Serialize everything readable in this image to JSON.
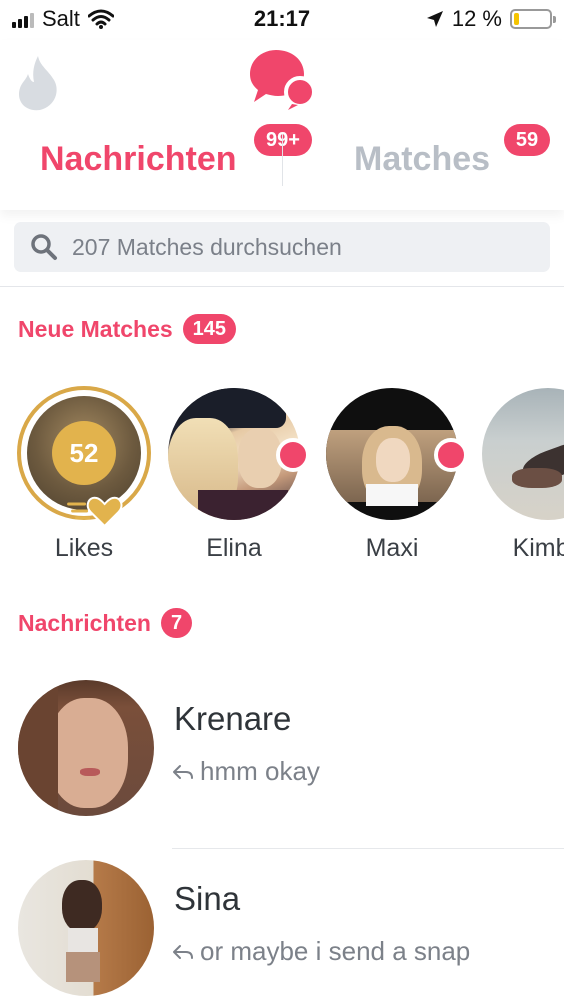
{
  "status_bar": {
    "carrier": "Salt",
    "time": "21:17",
    "battery_percent": "12 %",
    "battery_level": 0.12
  },
  "header": {
    "logo_icon": "chat-bubbles-icon",
    "flame_icon": "flame-icon",
    "tabs": [
      {
        "label": "Nachrichten",
        "badge": "99+",
        "active": true
      },
      {
        "label": "Matches",
        "badge": "59",
        "active": false
      }
    ]
  },
  "search": {
    "placeholder": "207 Matches durchsuchen"
  },
  "new_matches": {
    "title": "Neue Matches",
    "count": "145",
    "items": [
      {
        "name": "Likes",
        "count": "52",
        "type": "likes"
      },
      {
        "name": "Elina",
        "online": true
      },
      {
        "name": "Maxi",
        "online": true
      },
      {
        "name": "Kimbe",
        "online": false
      }
    ]
  },
  "messages": {
    "title": "Nachrichten",
    "count": "7",
    "conversations": [
      {
        "name": "Krenare",
        "preview": "hmm okay"
      },
      {
        "name": "Sina",
        "preview": "or maybe i send a snap"
      }
    ]
  },
  "colors": {
    "accent": "#f0466b",
    "inactive_tab": "#b8bec6",
    "gold": "#d9a848"
  }
}
